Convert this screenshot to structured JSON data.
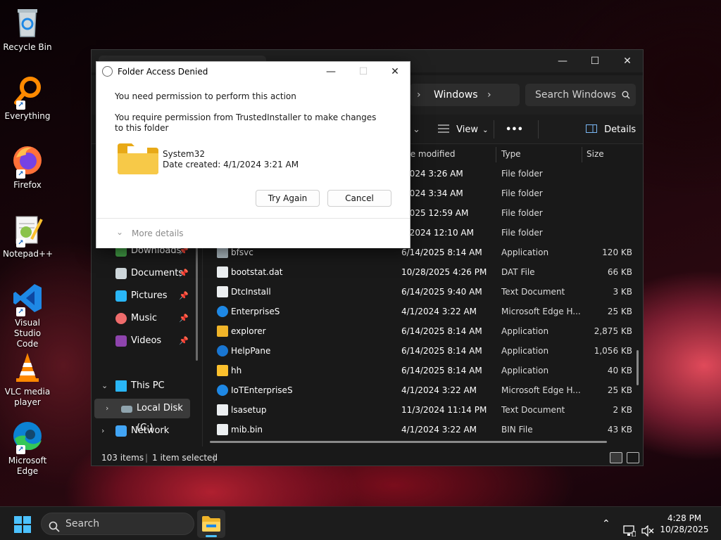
{
  "desktop": {
    "icons": [
      {
        "label": "Recycle Bin"
      },
      {
        "label": "Everything"
      },
      {
        "label": "Firefox"
      },
      {
        "label": "Notepad++"
      },
      {
        "label": "Visual Studio Code"
      },
      {
        "label": "VLC media player"
      },
      {
        "label": "Microsoft Edge"
      }
    ]
  },
  "explorer": {
    "breadcrumb": "Windows",
    "search_placeholder": "Search Windows",
    "toolbar": {
      "view": "View",
      "more": "•••",
      "details": "Details"
    },
    "columns": {
      "date": "te modified",
      "type": "Type",
      "size": "Size"
    },
    "sidebar": {
      "downloads": "Downloads",
      "documents": "Documents",
      "pictures": "Pictures",
      "music": "Music",
      "videos": "Videos",
      "this_pc": "This PC",
      "local_disk": "Local Disk (C:)",
      "network": "Network"
    },
    "rows": [
      {
        "name": "",
        "date": "/2024 3:26 AM",
        "type": "File folder",
        "size": ""
      },
      {
        "name": "",
        "date": "/2024 3:34 AM",
        "type": "File folder",
        "size": ""
      },
      {
        "name": "",
        "date": "/2025 12:59 AM",
        "type": "File folder",
        "size": ""
      },
      {
        "name": "",
        "date": "5/2024 12:10 AM",
        "type": "File folder",
        "size": ""
      },
      {
        "name": "bfsvc",
        "date": "6/14/2025 8:14 AM",
        "type": "Application",
        "size": "120 KB"
      },
      {
        "name": "bootstat.dat",
        "date": "10/28/2025 4:26 PM",
        "type": "DAT File",
        "size": "66 KB"
      },
      {
        "name": "DtcInstall",
        "date": "6/14/2025 9:40 AM",
        "type": "Text Document",
        "size": "3 KB"
      },
      {
        "name": "EnterpriseS",
        "date": "4/1/2024 3:22 AM",
        "type": "Microsoft Edge H...",
        "size": "25 KB"
      },
      {
        "name": "explorer",
        "date": "6/14/2025 8:14 AM",
        "type": "Application",
        "size": "2,875 KB"
      },
      {
        "name": "HelpPane",
        "date": "6/14/2025 8:14 AM",
        "type": "Application",
        "size": "1,056 KB"
      },
      {
        "name": "hh",
        "date": "6/14/2025 8:14 AM",
        "type": "Application",
        "size": "40 KB"
      },
      {
        "name": "IoTEnterpriseS",
        "date": "4/1/2024 3:22 AM",
        "type": "Microsoft Edge H...",
        "size": "25 KB"
      },
      {
        "name": "lsasetup",
        "date": "11/3/2024 11:14 PM",
        "type": "Text Document",
        "size": "2 KB"
      },
      {
        "name": "mib.bin",
        "date": "4/1/2024 3:22 AM",
        "type": "BIN File",
        "size": "43 KB"
      }
    ],
    "status": {
      "items": "103 items",
      "selected": "1 item selected"
    }
  },
  "dialog": {
    "title": "Folder Access Denied",
    "heading": "You need permission to perform this action",
    "message": "You require permission from TrustedInstaller to make changes to this folder",
    "folder_name": "System32",
    "date_created": "Date created: 4/1/2024 3:21 AM",
    "try_again": "Try Again",
    "cancel": "Cancel",
    "more_details": "More details"
  },
  "taskbar": {
    "search": "Search",
    "time": "4:28 PM",
    "date": "10/28/2025"
  },
  "colors": {
    "accent": "#4cc2ff",
    "folder": "#f3c24f"
  }
}
